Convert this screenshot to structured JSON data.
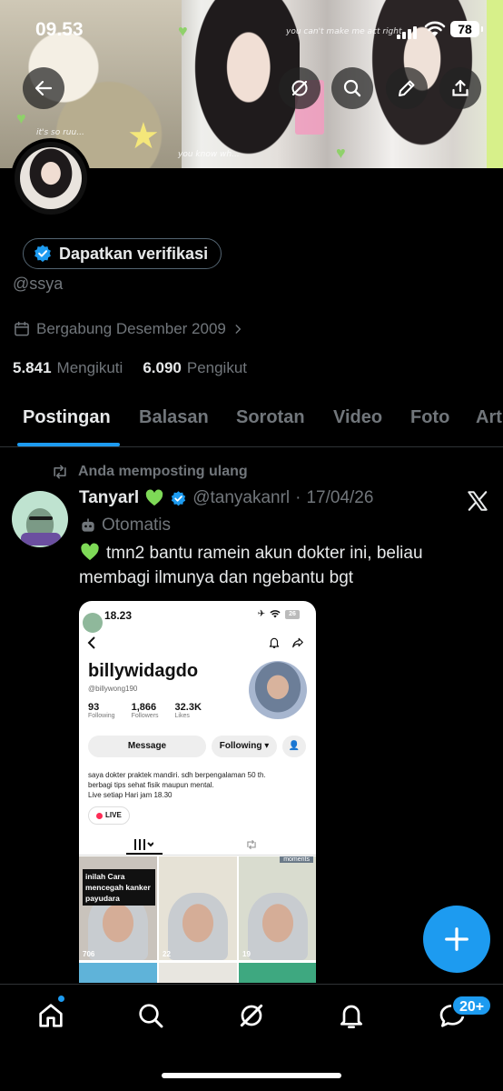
{
  "status_bar": {
    "time": "09.53",
    "battery": "78"
  },
  "banner": {
    "scribble_top": "you can't make me act right",
    "scribble_mid": "you know wh...",
    "scribble_left": "it's so ruu..."
  },
  "profile": {
    "verify_label": "Dapatkan verifikasi",
    "handle": "@ssya",
    "joined": "Bergabung Desember 2009",
    "following_count": "5.841",
    "following_label": "Mengikuti",
    "followers_count": "6.090",
    "followers_label": "Pengikut"
  },
  "tabs": [
    {
      "label": "Postingan",
      "active": true
    },
    {
      "label": "Balasan"
    },
    {
      "label": "Sorotan"
    },
    {
      "label": "Video"
    },
    {
      "label": "Foto"
    },
    {
      "label": "Art"
    }
  ],
  "post": {
    "repost_label": "Anda memposting ulang",
    "author_name": "Tanyarl",
    "author_handle": "@tanyakanrl",
    "separator": "·",
    "date": "17/04/26",
    "automated_label": "Otomatis",
    "text": "tmn2 bantu ramein akun dokter ini, beliau membagi ilmunya dan ngebantu bgt"
  },
  "embedded_screenshot": {
    "time": "18.23",
    "battery": "26",
    "username": "billywidagdo",
    "handle": "@billywong190",
    "stats": [
      {
        "value": "93",
        "label": "Following"
      },
      {
        "value": "1,866",
        "label": "Followers"
      },
      {
        "value": "32.3K",
        "label": "Likes"
      }
    ],
    "message_btn": "Message",
    "following_btn": "Following ▾",
    "bio_line1": "saya dokter praktek mandiri. sdh berpengalaman 50 th.",
    "bio_line2": "berbagi tips sehat fisik maupun mental.",
    "bio_line3": "Live setiap Hari jam 18.30",
    "live_label": "LIVE",
    "video1_caption": "inilah Cara mencegah kanker payudara",
    "video1_views": "706",
    "video2_views": "22",
    "video3_views": "19",
    "video3_tag": "moments"
  },
  "notifications_badge": "20+",
  "colors": {
    "accent": "#1d9bf0",
    "background": "#000000",
    "muted": "#71767b",
    "green_heart": "#7ed957"
  }
}
